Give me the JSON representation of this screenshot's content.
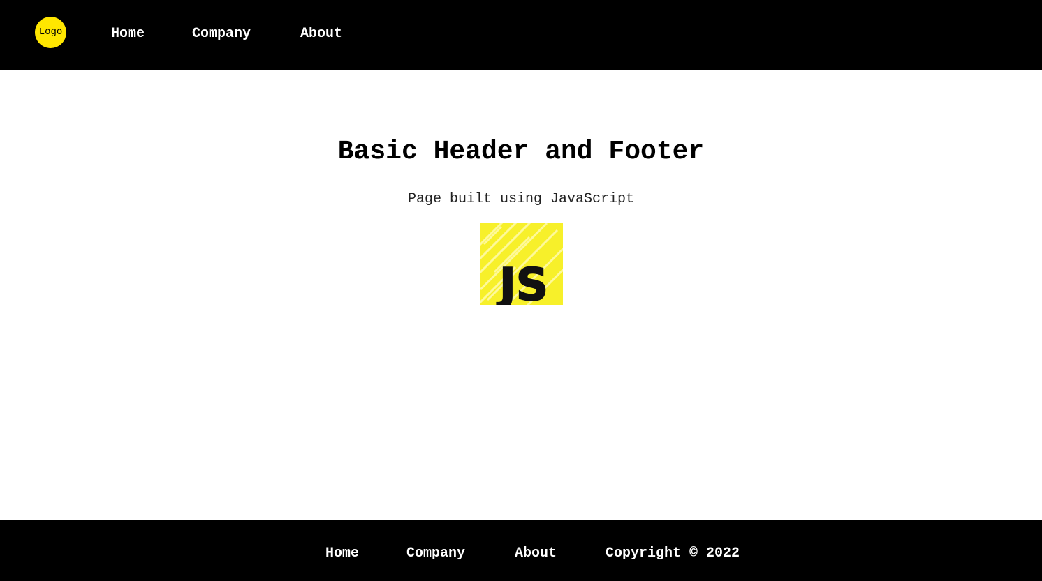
{
  "header": {
    "logo_text": "Logo",
    "nav": [
      {
        "label": "Home"
      },
      {
        "label": "Company"
      },
      {
        "label": "About"
      }
    ]
  },
  "main": {
    "title": "Basic Header and Footer",
    "subtitle": "Page built using JavaScript",
    "image_icon": "javascript-logo",
    "image_text": "JS"
  },
  "footer": {
    "links": [
      {
        "label": "Home"
      },
      {
        "label": "Company"
      },
      {
        "label": "About"
      }
    ],
    "copyright": "Copyright © 2022"
  },
  "colors": {
    "header_bg": "#000000",
    "footer_bg": "#000000",
    "logo_bg": "#ffe600",
    "js_yellow": "#f7f02a"
  }
}
